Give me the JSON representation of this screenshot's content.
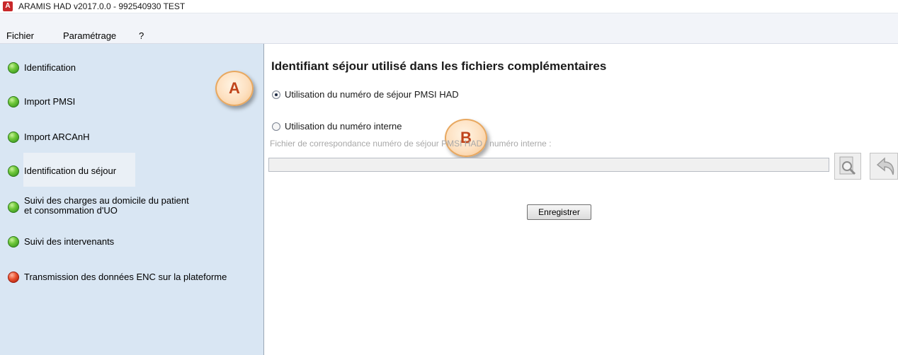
{
  "window": {
    "title": "ARAMIS HAD v2017.0.0  -  992540930  TEST"
  },
  "menu": {
    "items": [
      "Fichier",
      "Paramétrage",
      "?"
    ]
  },
  "sidebar": {
    "items": [
      {
        "label": "Identification",
        "status": "green"
      },
      {
        "label": "Import PMSI",
        "status": "green"
      },
      {
        "label": "Import ARCAnH",
        "status": "green"
      },
      {
        "label": "Identification du séjour",
        "status": "green",
        "selected": true
      },
      {
        "label_line1": "Suivi des charges au domicile du patient",
        "label_line2": "et consommation d'UO",
        "status": "green"
      },
      {
        "label": "Suivi des intervenants",
        "status": "green"
      },
      {
        "label": "Transmission des données ENC sur la plateforme",
        "status": "red"
      }
    ]
  },
  "callouts": {
    "a": "A",
    "b": "B"
  },
  "main": {
    "title": "Identifiant séjour utilisé dans les fichiers complémentaires",
    "option_pmsi": {
      "label": "Utilisation du numéro de séjour PMSI HAD",
      "checked": true
    },
    "option_internal": {
      "label": "Utilisation du numéro interne",
      "checked": false
    },
    "file_field_label": "Fichier de correspondance numéro de séjour PMSI HAD / numéro interne :",
    "file_field_value": "",
    "save_label": "Enregistrer"
  },
  "icons": {
    "browse": "magnifier-icon",
    "reset": "undo-icon",
    "status_ok": "green-bullet-icon",
    "status_error": "red-bullet-icon"
  },
  "colors": {
    "sidebar_bg": "#d9e6f3",
    "status_green": "#3fa326",
    "status_red": "#e0452a",
    "callout_text": "#c0441b"
  }
}
